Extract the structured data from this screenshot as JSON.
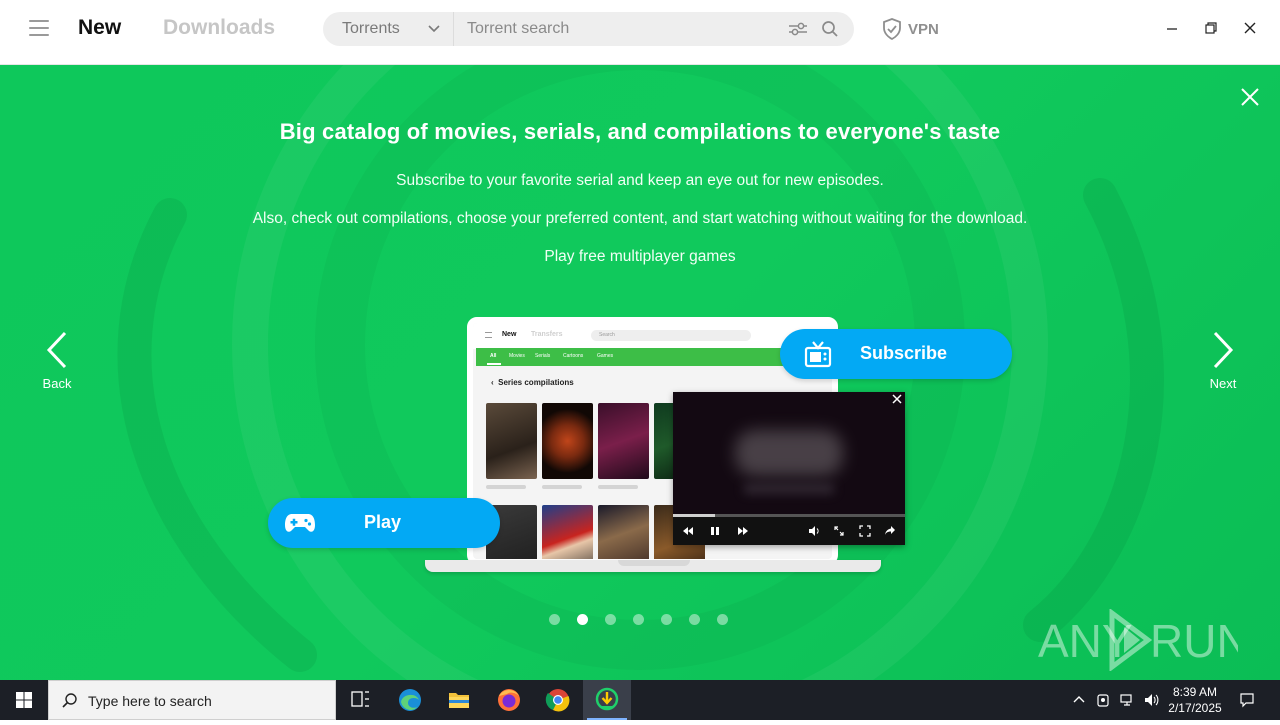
{
  "app": {
    "tabs": {
      "new": "New",
      "downloads": "Downloads"
    },
    "search": {
      "category": "Torrents",
      "placeholder": "Torrent search"
    },
    "vpn_label": "VPN"
  },
  "banner": {
    "headline": "Big catalog of movies, serials, and compilations to everyone's taste",
    "lines": [
      "Subscribe to your favorite serial and keep an eye out for new episodes.",
      "Also, check out compilations, choose your preferred content, and start watching without waiting for the download.",
      "Play free multiplayer games"
    ],
    "back_label": "Back",
    "next_label": "Next",
    "subscribe_label": "Subscribe",
    "play_label": "Play",
    "slide_count": 7,
    "active_slide": 1
  },
  "mockup": {
    "tab_new": "New",
    "tab_transfers": "Transfers",
    "search_placeholder": "Search",
    "nav": [
      "All",
      "Movies",
      "Serials",
      "Cartoons",
      "Games"
    ],
    "heading": "Series compilations"
  },
  "taskbar": {
    "search_placeholder": "Type here to search",
    "time": "8:39 AM",
    "date": "2/17/2025"
  },
  "colors": {
    "banner_green": "#10c95c",
    "accent_blue": "#03a9f4",
    "taskbar": "#1c1f26"
  }
}
